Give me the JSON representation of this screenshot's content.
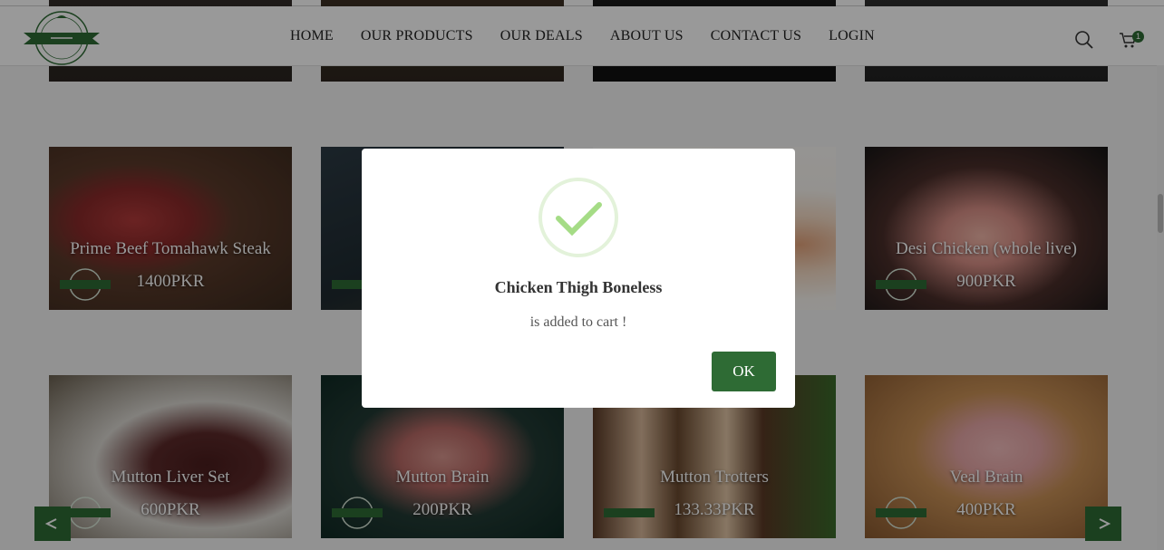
{
  "nav": {
    "items": [
      "HOME",
      "OUR PRODUCTS",
      "OUR DEALS",
      "ABOUT US",
      "CONTACT US",
      "LOGIN"
    ]
  },
  "cart": {
    "count": "1"
  },
  "products": [
    {
      "name": "Prime Beef Tomahawk Steak",
      "price": "1400PKR"
    },
    {
      "name": "",
      "price": ""
    },
    {
      "name": "",
      "price": ""
    },
    {
      "name": "Desi Chicken (whole live)",
      "price": "900PKR"
    },
    {
      "name": "Mutton Liver Set",
      "price": "600PKR"
    },
    {
      "name": "Mutton Brain",
      "price": "200PKR"
    },
    {
      "name": "Mutton Trotters",
      "price": "133.33PKR"
    },
    {
      "name": "Veal Brain",
      "price": "400PKR"
    }
  ],
  "modal": {
    "title": "Chicken Thigh Boneless",
    "message": "is added to cart !",
    "ok_label": "OK"
  },
  "colors": {
    "brand_green": "#2e6b34",
    "check_green": "#a5dc86"
  }
}
